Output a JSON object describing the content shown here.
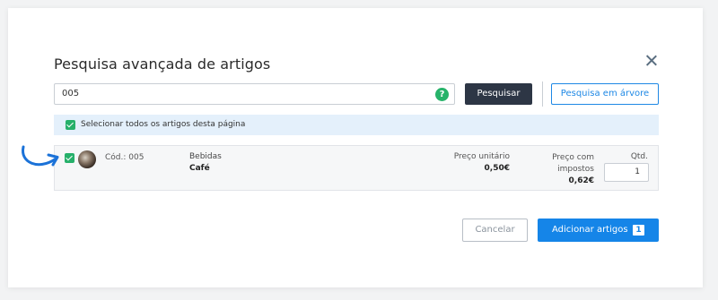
{
  "dialog": {
    "title": "Pesquisa avançada de artigos",
    "close_icon": "close-icon"
  },
  "search": {
    "value": "005",
    "help_icon": "question-icon",
    "help_glyph": "?"
  },
  "buttons": {
    "search_label": "Pesquisar",
    "tree_search_label": "Pesquisa em árvore",
    "cancel_label": "Cancelar",
    "add_label": "Adicionar artigos",
    "add_count": "1"
  },
  "select_all": {
    "label": "Selecionar todos os artigos desta página",
    "checked": true
  },
  "articles": [
    {
      "checked": true,
      "code": "Cód.: 005",
      "category": "Bebidas",
      "name": "Café",
      "unit_price_label": "Preço unitário",
      "unit_price": "0,50€",
      "tax_price_label": "Preço com impostos",
      "tax_price": "0,62€",
      "qty_label": "Qtd.",
      "qty": "1"
    }
  ],
  "colors": {
    "accent": "#1585e8",
    "dark_button": "#2d3645",
    "checkbox": "#26b06a",
    "help": "#27b36a",
    "select_all_bg": "#e4f0fb"
  }
}
